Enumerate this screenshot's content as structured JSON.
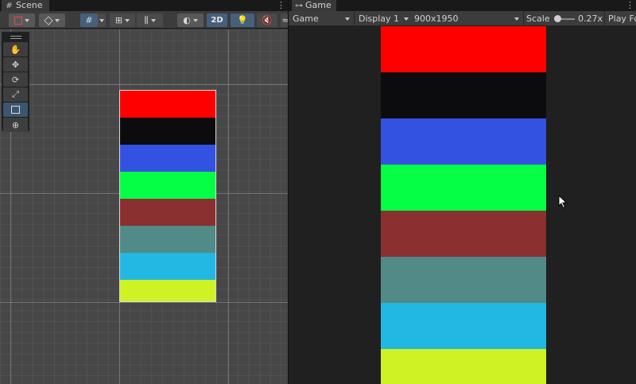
{
  "scene_tab": {
    "label": "Scene",
    "icon": "grid-icon"
  },
  "game_tab": {
    "label": "Game",
    "icon": "gamepad-icon"
  },
  "scene_toolbar": {
    "mode_2d_label": "2D"
  },
  "tools": [
    {
      "name": "hand-tool",
      "icon": "hand-icon",
      "glyph": "✋"
    },
    {
      "name": "move-tool",
      "icon": "move-icon",
      "glyph": "✥"
    },
    {
      "name": "rotate-tool",
      "icon": "rotate-icon",
      "glyph": "⟳"
    },
    {
      "name": "scale-tool",
      "icon": "scale-icon",
      "glyph": "⤢"
    },
    {
      "name": "rect-tool",
      "icon": "rect-icon",
      "glyph": ""
    },
    {
      "name": "transform-tool",
      "icon": "transform-icon",
      "glyph": "⊕"
    }
  ],
  "game_toolbar": {
    "view_select": "Game",
    "display_select": "Display 1",
    "resolution_select": "900x1950",
    "scale_label": "Scale",
    "scale_value": "0.27x",
    "play_label": "Play Fo"
  },
  "stripes": [
    {
      "color": "#FF0000"
    },
    {
      "color": "#0C0C0E"
    },
    {
      "color": "#3452E2"
    },
    {
      "color": "#04FF44"
    },
    {
      "color": "#8A3030"
    },
    {
      "color": "#518A86"
    },
    {
      "color": "#22B8E3"
    },
    {
      "color": "#CFF225"
    }
  ]
}
